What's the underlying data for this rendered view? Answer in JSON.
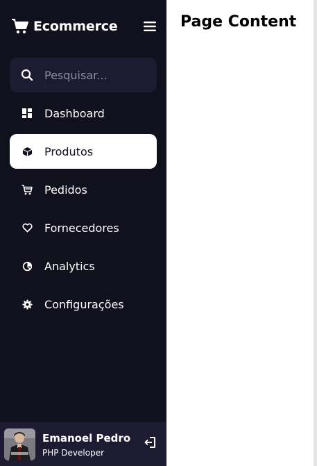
{
  "brand": {
    "name": "Ecommerce",
    "icon": "shopping-cart-icon"
  },
  "search": {
    "placeholder": "Pesquisar..."
  },
  "sidebar": {
    "items": [
      {
        "label": "Dashboard",
        "icon": "grid-icon",
        "active": false
      },
      {
        "label": "Produtos",
        "icon": "box-icon",
        "active": true
      },
      {
        "label": "Pedidos",
        "icon": "cart-icon",
        "active": false
      },
      {
        "label": "Fornecedores",
        "icon": "heart-icon",
        "active": false
      },
      {
        "label": "Analytics",
        "icon": "pie-chart-icon",
        "active": false
      },
      {
        "label": "Configurações",
        "icon": "cog-icon",
        "active": false
      }
    ]
  },
  "profile": {
    "name": "Emanoel Pedro",
    "job": "PHP Developer"
  },
  "main": {
    "title": "Page Content"
  },
  "colors": {
    "sidebar_bg": "#11101d",
    "sidebar_secondary": "#1d1b31",
    "active_bg": "#ffffff",
    "text": "#ffffff"
  }
}
